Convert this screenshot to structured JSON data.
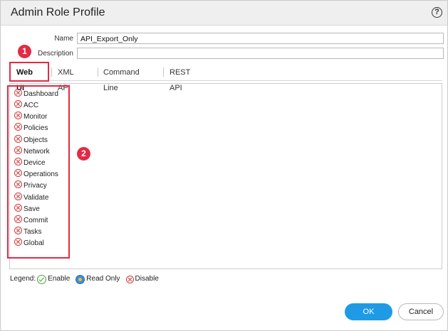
{
  "dialog": {
    "title": "Admin Role Profile",
    "help_icon": "help-circle-icon"
  },
  "form": {
    "name_label": "Name",
    "name_value": "API_Export_Only",
    "description_label": "Description",
    "description_value": ""
  },
  "tabs": [
    {
      "label": "Web UI",
      "active": true
    },
    {
      "label": "XML API",
      "active": false
    },
    {
      "label": "Command Line",
      "active": false
    },
    {
      "label": "REST API",
      "active": false
    }
  ],
  "permissions": [
    {
      "label": "Dashboard",
      "state": "disable"
    },
    {
      "label": "ACC",
      "state": "disable"
    },
    {
      "label": "Monitor",
      "state": "disable"
    },
    {
      "label": "Policies",
      "state": "disable"
    },
    {
      "label": "Objects",
      "state": "disable"
    },
    {
      "label": "Network",
      "state": "disable"
    },
    {
      "label": "Device",
      "state": "disable"
    },
    {
      "label": "Operations",
      "state": "disable"
    },
    {
      "label": "Privacy",
      "state": "disable"
    },
    {
      "label": "Validate",
      "state": "disable"
    },
    {
      "label": "Save",
      "state": "disable"
    },
    {
      "label": "Commit",
      "state": "disable"
    },
    {
      "label": "Tasks",
      "state": "disable"
    },
    {
      "label": "Global",
      "state": "disable"
    }
  ],
  "annotations": {
    "badge1": "1",
    "badge2": "2",
    "color": "#e32a45"
  },
  "legend": {
    "prefix": "Legend:",
    "enable": "Enable",
    "read_only": "Read Only",
    "disable": "Disable"
  },
  "buttons": {
    "ok": "OK",
    "cancel": "Cancel",
    "ok_color": "#1f9be6"
  }
}
